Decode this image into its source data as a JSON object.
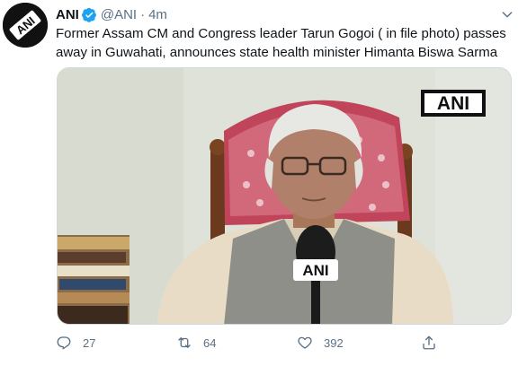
{
  "tweet": {
    "author_name": "ANI",
    "handle": "@ANI",
    "separator": "·",
    "time": "4m",
    "text": "Former Assam CM and Congress leader Tarun Gogoi ( in file photo) passes away in Guwahati, announces state health minister Himanta Biswa Sarma",
    "avatar_logo_text": "ANI",
    "media_watermark": "ANI",
    "mic_label": "ANI"
  },
  "actions": {
    "reply_count": "27",
    "retweet_count": "64",
    "like_count": "392"
  },
  "icons": {
    "verified": "verified-badge-icon",
    "caret": "chevron-down-icon",
    "reply": "reply-icon",
    "retweet": "retweet-icon",
    "like": "heart-icon",
    "share": "share-icon"
  },
  "colors": {
    "verified_blue": "#1da1f2",
    "secondary_text": "#5b7083",
    "primary_text": "#0f1419"
  }
}
